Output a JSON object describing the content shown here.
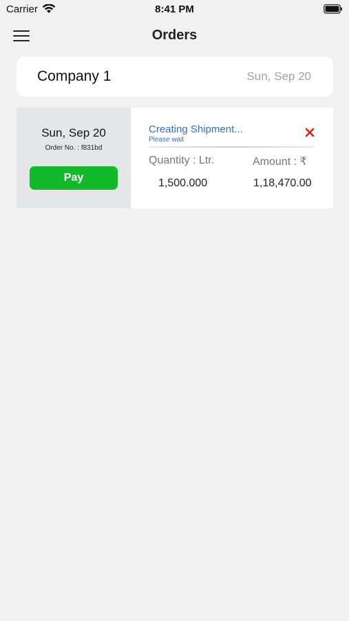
{
  "status_bar": {
    "carrier": "Carrier",
    "time": "8:41 PM"
  },
  "header": {
    "title": "Orders",
    "menu_icon": "hamburger-menu-icon"
  },
  "company": {
    "name": "Company 1",
    "date": "Sun, Sep 20"
  },
  "order": {
    "date": "Sun, Sep 20",
    "order_no": "Order No. : f831bd",
    "pay_label": "Pay",
    "status_title": "Creating Shipment...",
    "status_subtitle": "Please wait",
    "cancel_icon": "close-x-icon",
    "quantity_label": "Quantity : Ltr.",
    "amount_label": "Amount : ₹",
    "quantity_value": "1,500.000",
    "amount_value": "1,18,470.00"
  },
  "colors": {
    "background": "#f1f1f1",
    "pay_green": "#12b92a",
    "status_blue": "#2f6fd6",
    "cancel_red": "#e0201c",
    "order_left_panel": "#e4e6e8"
  }
}
